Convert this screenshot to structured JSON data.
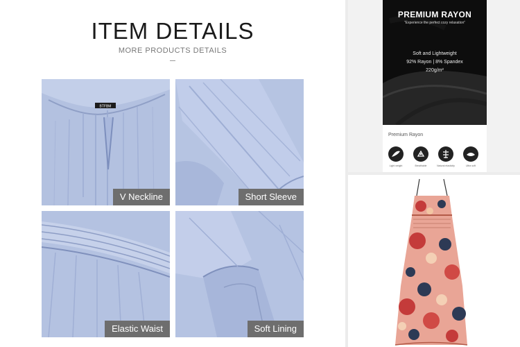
{
  "details": {
    "title": "ITEM DETAILS",
    "subtitle": "MORE PRODUCTS DETAILS",
    "tiles": [
      {
        "caption": "V Neckline",
        "label_tag": "BTFBM"
      },
      {
        "caption": "Short Sleeve"
      },
      {
        "caption": "Elastic Waist"
      },
      {
        "caption": "Soft Lining"
      }
    ]
  },
  "rayon": {
    "title": "PREMIUM RAYON",
    "tagline": "\"Experience the perfect cozy relaxation\"",
    "line1": "Soft and Lightweight",
    "line2": "92% Rayon | 8% Spandex",
    "line3": "220g/m²",
    "section_label": "Premium Rayon",
    "features": [
      {
        "icon": "feather-icon",
        "label": "Light weight"
      },
      {
        "icon": "breathable-icon",
        "label": "Breathable"
      },
      {
        "icon": "skin-friendly-icon",
        "label": "Natural elasticity"
      },
      {
        "icon": "soft-icon",
        "label": "Ultra soft"
      }
    ]
  },
  "colors": {
    "fabric_blue": "#aebdde",
    "caption_bg": "#6e6e6e",
    "rayon_black": "#0d0d0d",
    "floral_pink": "#e9a596",
    "floral_navy": "#2d3a55"
  }
}
